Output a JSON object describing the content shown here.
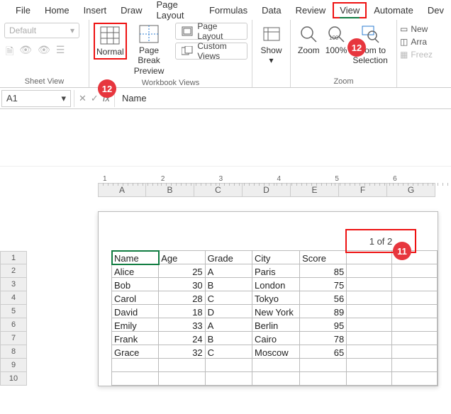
{
  "menu": {
    "items": [
      "File",
      "Home",
      "Insert",
      "Draw",
      "Page Layout",
      "Formulas",
      "Data",
      "Review",
      "View",
      "Automate",
      "Dev"
    ],
    "active": "View"
  },
  "ribbon": {
    "sheetview": {
      "default_label": "Default",
      "group_label": "Sheet View"
    },
    "workbook_views": {
      "normal": "Normal",
      "page_break": "Page Break\nPreview",
      "page_layout_btn": "Page Layout",
      "custom_views_btn": "Custom Views",
      "group_label": "Workbook Views"
    },
    "show": {
      "label": "Show"
    },
    "zoom": {
      "zoom": "Zoom",
      "hundred": "100%",
      "to_selection": "Zoom to\nSelection",
      "group_label": "Zoom"
    },
    "side": {
      "new_window": "New",
      "arrange": "Arra",
      "freeze": "Freez"
    }
  },
  "formula_bar": {
    "cell_ref": "A1",
    "value": "Name"
  },
  "ruler": {
    "ticks": [
      "1",
      "2",
      "3",
      "4",
      "5",
      "6"
    ]
  },
  "columns": [
    "A",
    "B",
    "C",
    "D",
    "E",
    "F",
    "G"
  ],
  "rows": [
    "1",
    "2",
    "3",
    "4",
    "5",
    "6",
    "7",
    "8",
    "9",
    "10"
  ],
  "page_header": "1 of 2",
  "chart_data": {
    "type": "table",
    "headers": [
      "Name",
      "Age",
      "Grade",
      "City",
      "Score"
    ],
    "rows": [
      [
        "Alice",
        25,
        "A",
        "Paris",
        85
      ],
      [
        "Bob",
        30,
        "B",
        "London",
        75
      ],
      [
        "Carol",
        28,
        "C",
        "Tokyo",
        56
      ],
      [
        "David",
        18,
        "D",
        "New York",
        89
      ],
      [
        "Emily",
        33,
        "A",
        "Berlin",
        95
      ],
      [
        "Frank",
        24,
        "B",
        "Cairo",
        78
      ],
      [
        "Grace",
        32,
        "C",
        "Moscow",
        65
      ]
    ]
  },
  "annotations": {
    "b11": "11",
    "b12a": "12",
    "b12b": "12"
  }
}
